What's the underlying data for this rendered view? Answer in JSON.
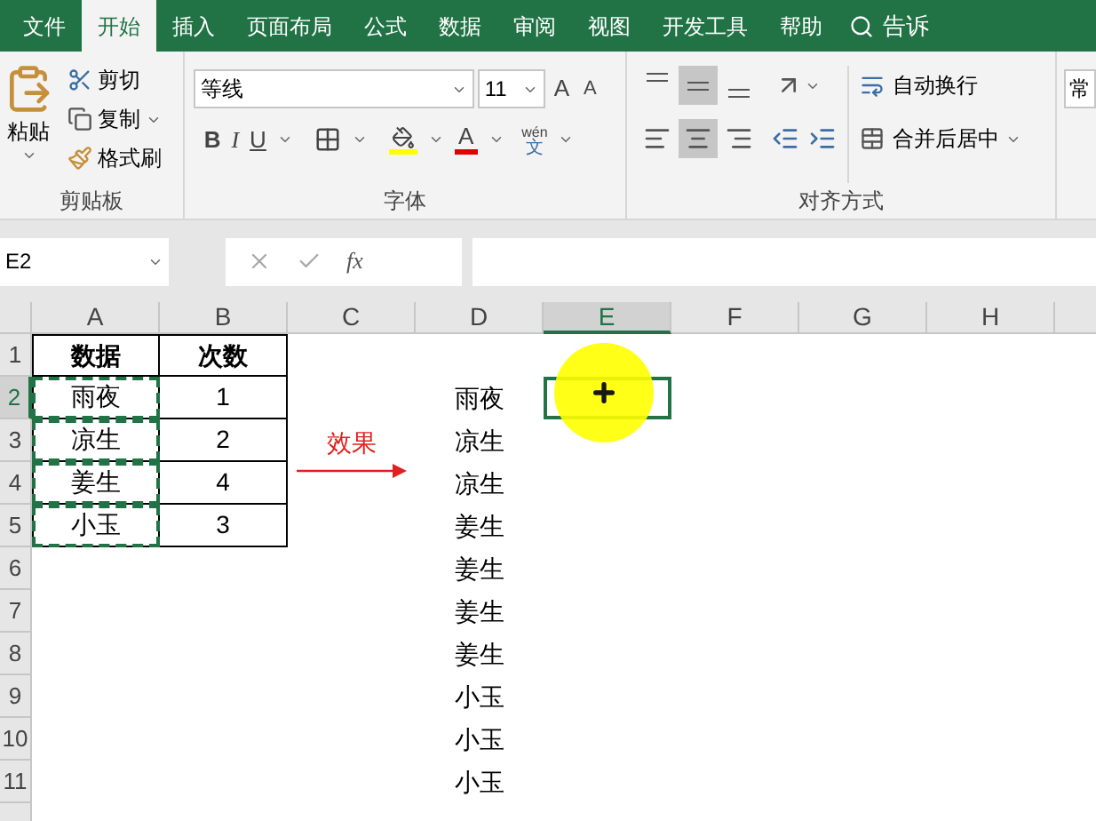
{
  "tabs": [
    {
      "label": "文件",
      "selected": false
    },
    {
      "label": "开始",
      "selected": true
    },
    {
      "label": "插入",
      "selected": false
    },
    {
      "label": "页面布局",
      "selected": false
    },
    {
      "label": "公式",
      "selected": false
    },
    {
      "label": "数据",
      "selected": false
    },
    {
      "label": "审阅",
      "selected": false
    },
    {
      "label": "视图",
      "selected": false
    },
    {
      "label": "开发工具",
      "selected": false
    },
    {
      "label": "帮助",
      "selected": false
    }
  ],
  "search": {
    "label": "告诉"
  },
  "clipboard": {
    "label": "剪贴板",
    "paste": "粘贴",
    "cut": "剪切",
    "copy": "复制",
    "format_painter": "格式刷"
  },
  "font": {
    "label": "字体",
    "font_name": "等线",
    "font_size": "11",
    "grow": "A",
    "shrink": "A",
    "bold": "B",
    "italic": "I",
    "underline": "U",
    "font_color": "A",
    "phonetic_top": "wén",
    "phonetic_bottom": "文"
  },
  "alignment": {
    "label": "对齐方式",
    "vertical": [
      {
        "kind": "top",
        "selected": false
      },
      {
        "kind": "middle",
        "selected": true
      },
      {
        "kind": "bottom",
        "selected": false
      }
    ],
    "horizontal": [
      {
        "kind": "left",
        "selected": false
      },
      {
        "kind": "center",
        "selected": true
      },
      {
        "kind": "right",
        "selected": false
      }
    ],
    "wrap_text": "自动换行",
    "merge_center": "合并后居中"
  },
  "number": {
    "format": "常"
  },
  "formula_bar": {
    "name_box": "E2",
    "fx": "fx"
  },
  "columns": [
    {
      "label": "A",
      "selected": false
    },
    {
      "label": "B",
      "selected": false
    },
    {
      "label": "C",
      "selected": false
    },
    {
      "label": "D",
      "selected": false
    },
    {
      "label": "E",
      "selected": true
    },
    {
      "label": "F",
      "selected": false
    },
    {
      "label": "G",
      "selected": false
    },
    {
      "label": "H",
      "selected": false
    }
  ],
  "rows": [
    {
      "number": "1",
      "selected": false,
      "cells": {
        "A": {
          "text": "数据",
          "kind": "header",
          "copied": false
        },
        "B": {
          "text": "次数",
          "kind": "header",
          "copied": false
        }
      }
    },
    {
      "number": "2",
      "selected": true,
      "cells": {
        "A": {
          "text": "雨夜",
          "kind": "bordered",
          "copied": true
        },
        "B": {
          "text": "1",
          "kind": "bordered",
          "copied": false
        },
        "D": {
          "text": "雨夜",
          "kind": "plain",
          "copied": false
        }
      }
    },
    {
      "number": "3",
      "selected": false,
      "cells": {
        "A": {
          "text": "凉生",
          "kind": "bordered",
          "copied": true
        },
        "B": {
          "text": "2",
          "kind": "bordered",
          "copied": false
        },
        "C": {
          "text": "效果",
          "kind": "annotation",
          "copied": false
        },
        "D": {
          "text": "凉生",
          "kind": "plain",
          "copied": false
        }
      }
    },
    {
      "number": "4",
      "selected": false,
      "cells": {
        "A": {
          "text": "姜生",
          "kind": "bordered",
          "copied": true
        },
        "B": {
          "text": "4",
          "kind": "bordered",
          "copied": false
        },
        "D": {
          "text": "凉生",
          "kind": "plain",
          "copied": false
        }
      }
    },
    {
      "number": "5",
      "selected": false,
      "cells": {
        "A": {
          "text": "小玉",
          "kind": "bordered",
          "copied": true
        },
        "B": {
          "text": "3",
          "kind": "bordered",
          "copied": false
        },
        "D": {
          "text": "姜生",
          "kind": "plain",
          "copied": false
        }
      }
    },
    {
      "number": "6",
      "selected": false,
      "cells": {
        "D": {
          "text": "姜生",
          "kind": "plain",
          "copied": false
        }
      }
    },
    {
      "number": "7",
      "selected": false,
      "cells": {
        "D": {
          "text": "姜生",
          "kind": "plain",
          "copied": false
        }
      }
    },
    {
      "number": "8",
      "selected": false,
      "cells": {
        "D": {
          "text": "姜生",
          "kind": "plain",
          "copied": false
        }
      }
    },
    {
      "number": "9",
      "selected": false,
      "cells": {
        "D": {
          "text": "小玉",
          "kind": "plain",
          "copied": false
        }
      }
    },
    {
      "number": "10",
      "selected": false,
      "cells": {
        "D": {
          "text": "小玉",
          "kind": "plain",
          "copied": false
        }
      }
    },
    {
      "number": "11",
      "selected": false,
      "cells": {
        "D": {
          "text": "小玉",
          "kind": "plain",
          "copied": false
        }
      }
    }
  ]
}
